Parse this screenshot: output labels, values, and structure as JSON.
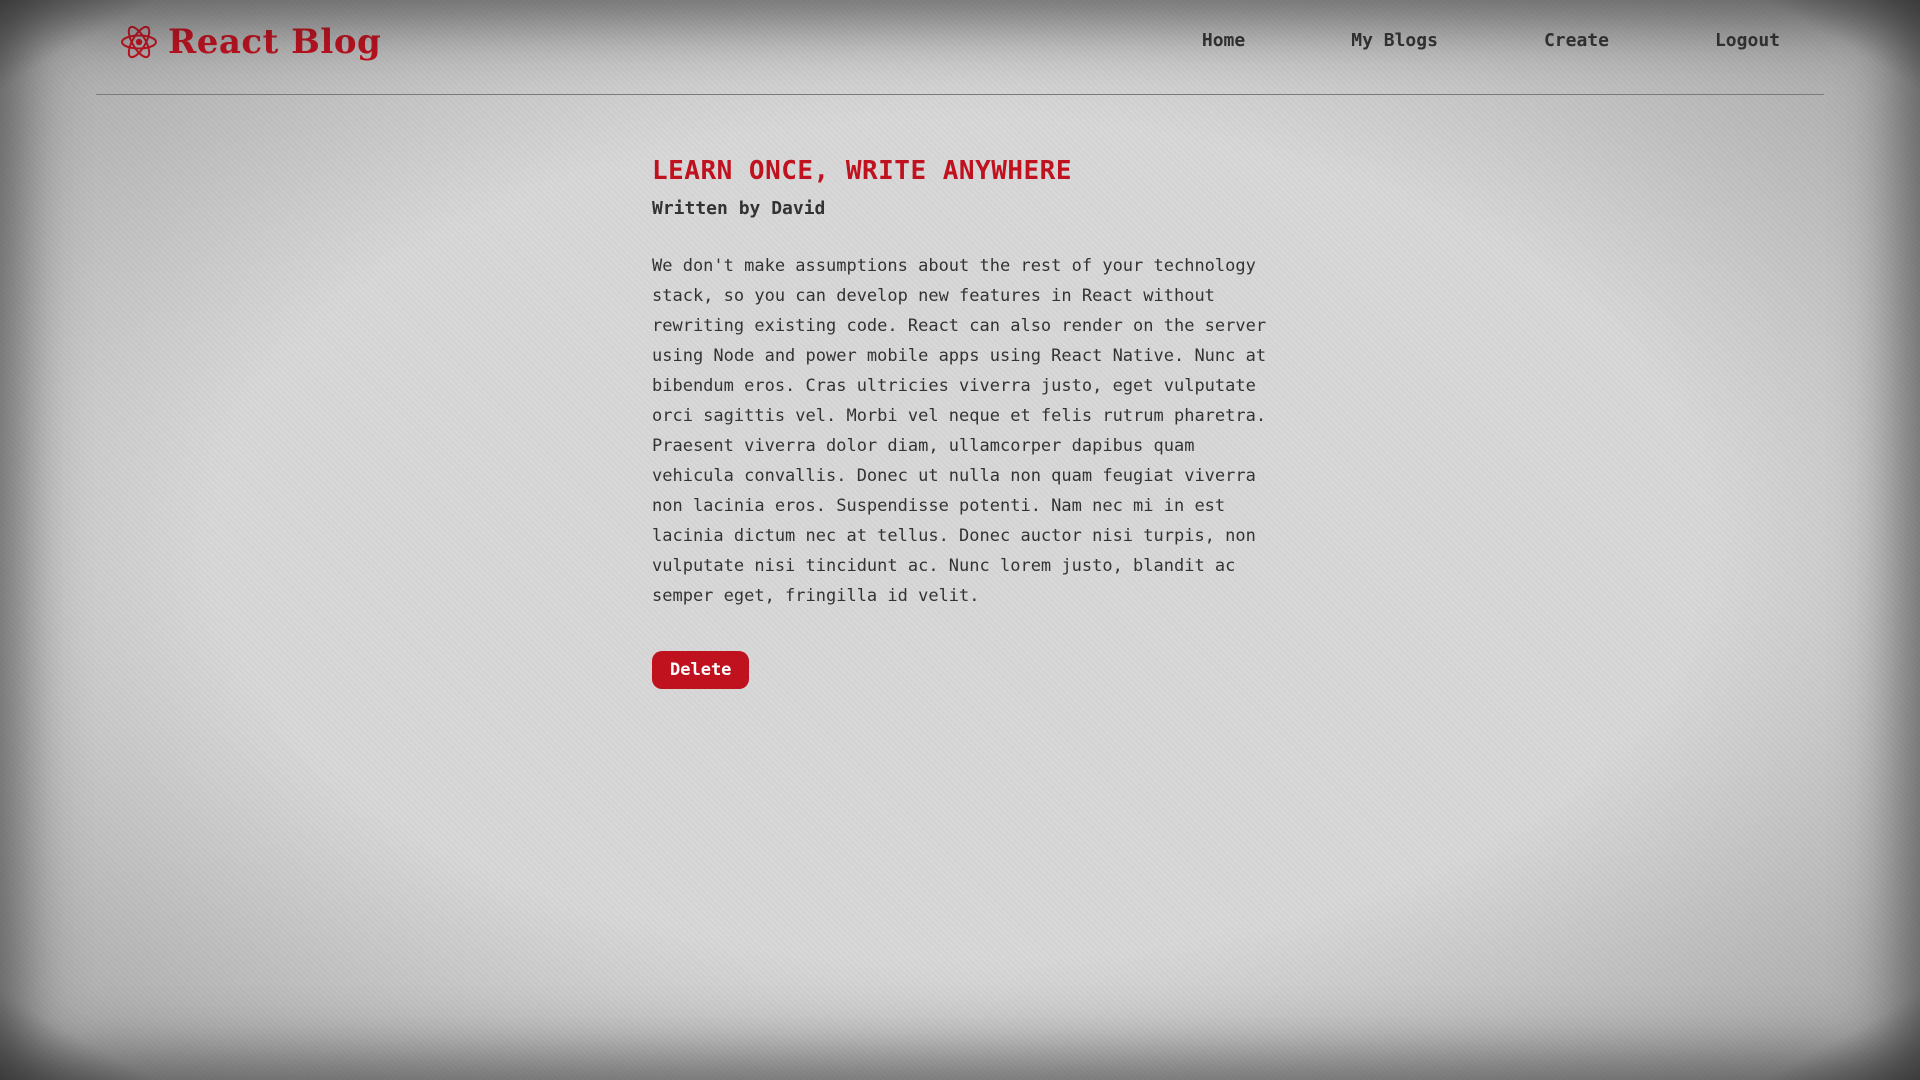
{
  "brand": {
    "title": "React Blog",
    "icon": "react-atom-icon",
    "color": "#c0111f"
  },
  "nav": {
    "items": [
      {
        "label": "Home"
      },
      {
        "label": "My Blogs"
      },
      {
        "label": "Create"
      },
      {
        "label": "Logout"
      }
    ]
  },
  "article": {
    "title": "LEARN ONCE, WRITE ANYWHERE",
    "author_line": "Written by David",
    "body": "We don't make assumptions about the rest of your technology stack, so you can develop new features in React without rewriting existing code. React can also render on the server using Node and power mobile apps using React Native. Nunc at bibendum eros. Cras ultricies viverra justo, eget vulputate orci sagittis vel. Morbi vel neque et felis rutrum pharetra. Praesent viverra dolor diam, ullamcorper dapibus quam vehicula convallis. Donec ut nulla non quam feugiat viverra non lacinia eros. Suspendisse potenti. Nam nec mi in est lacinia dictum nec at tellus. Donec auctor nisi turpis, non vulputate nisi tincidunt ac. Nunc lorem justo, blandit ac semper eget, fringilla id velit.",
    "delete_label": "Delete"
  },
  "colors": {
    "accent": "#c0111f",
    "background": "#d7d7d7",
    "text": "#333333"
  }
}
